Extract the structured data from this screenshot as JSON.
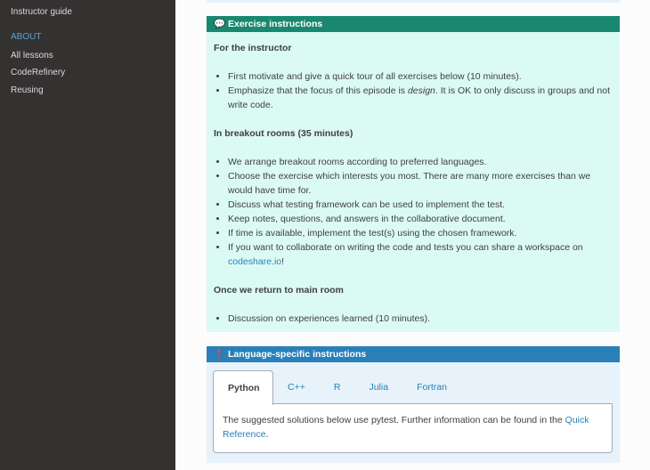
{
  "sidebar": {
    "instructor_guide": "Instructor guide",
    "about_caption": "ABOUT",
    "items": [
      "All lessons",
      "CodeRefinery",
      "Reusing"
    ]
  },
  "exercise": {
    "icon": "comment-icon",
    "title": "Exercise instructions",
    "instructor_heading": "For the instructor",
    "instructor_items": [
      "First motivate and give a quick tour of all exercises below (10 minutes).",
      "Emphasize that the focus of this episode is ",
      "design",
      ". It is OK to only discuss in groups and not write code."
    ],
    "breakout_heading": "In breakout rooms (35 minutes)",
    "breakout_items": [
      "We arrange breakout rooms according to preferred languages.",
      "Choose the exercise which interests you most. There are many more exercises than we would have time for.",
      "Discuss what testing framework can be used to implement the test.",
      "Keep notes, questions, and answers in the collaborative document.",
      "If time is available, implement the test(s) using the chosen framework.",
      "If you want to collaborate on writing the code and tests you can share a workspace on ",
      "codeshare.io",
      "!"
    ],
    "return_heading": "Once we return to main room",
    "return_items": [
      "Discussion on experiences learned (10 minutes)."
    ]
  },
  "lang": {
    "icon": "exclamation-circle-icon",
    "title": "Language-specific instructions",
    "tabs": [
      "Python",
      "C++",
      "R",
      "Julia",
      "Fortran"
    ],
    "active_tab": "Python",
    "panel_text": "The suggested solutions below use pytest. Further information can be found in the ",
    "panel_link": "Quick Reference",
    "panel_end": "."
  }
}
